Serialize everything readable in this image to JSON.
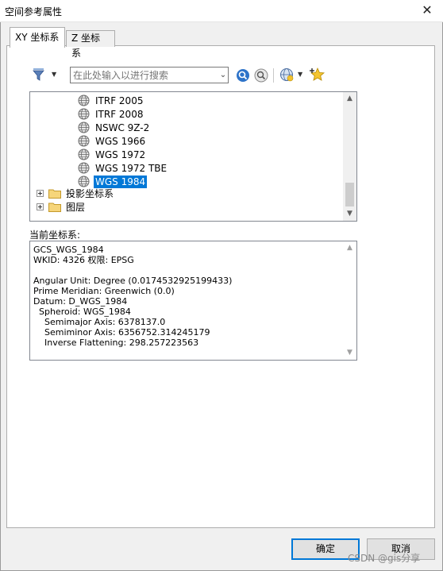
{
  "window": {
    "title": "空间参考属性",
    "close_glyph": "✕"
  },
  "tabs": [
    {
      "label": "XY 坐标系",
      "active": true
    },
    {
      "label": "Z 坐标系",
      "active": false
    }
  ],
  "toolbar": {
    "search_placeholder": "在此处输入以进行搜索",
    "dropdown_glyph": "▼",
    "combo_glyph": "⌄"
  },
  "tree": {
    "items": [
      {
        "label": "ITRF 2005",
        "icon": "globe-icon"
      },
      {
        "label": "ITRF 2008",
        "icon": "globe-icon"
      },
      {
        "label": "NSWC 9Z-2",
        "icon": "globe-icon"
      },
      {
        "label": "WGS 1966",
        "icon": "globe-icon"
      },
      {
        "label": "WGS 1972",
        "icon": "globe-icon"
      },
      {
        "label": "WGS 1972 TBE",
        "icon": "globe-icon"
      },
      {
        "label": "WGS 1984",
        "icon": "globe-icon",
        "selected": true
      }
    ],
    "folders": [
      {
        "label": "投影坐标系",
        "icon": "folder-icon"
      },
      {
        "label": "图层",
        "icon": "folder-icon"
      }
    ],
    "scroll_up": "▲",
    "scroll_down": "▼"
  },
  "current": {
    "label": "当前坐标系:",
    "lines": [
      "GCS_WGS_1984",
      "WKID: 4326 权限: EPSG",
      "",
      "Angular Unit: Degree (0.0174532925199433)",
      "Prime Meridian: Greenwich (0.0)",
      "Datum: D_WGS_1984",
      "  Spheroid: WGS_1984",
      "    Semimajor Axis: 6378137.0",
      "    Semiminor Axis: 6356752.314245179",
      "    Inverse Flattening: 298.257223563"
    ],
    "scroll_up": "▲",
    "scroll_down": "▼"
  },
  "buttons": {
    "ok": "确定",
    "cancel": "取消"
  },
  "watermark": "CSDN @gis分享",
  "colors": {
    "selection": "#0078d7",
    "accent": "#0078d7"
  }
}
